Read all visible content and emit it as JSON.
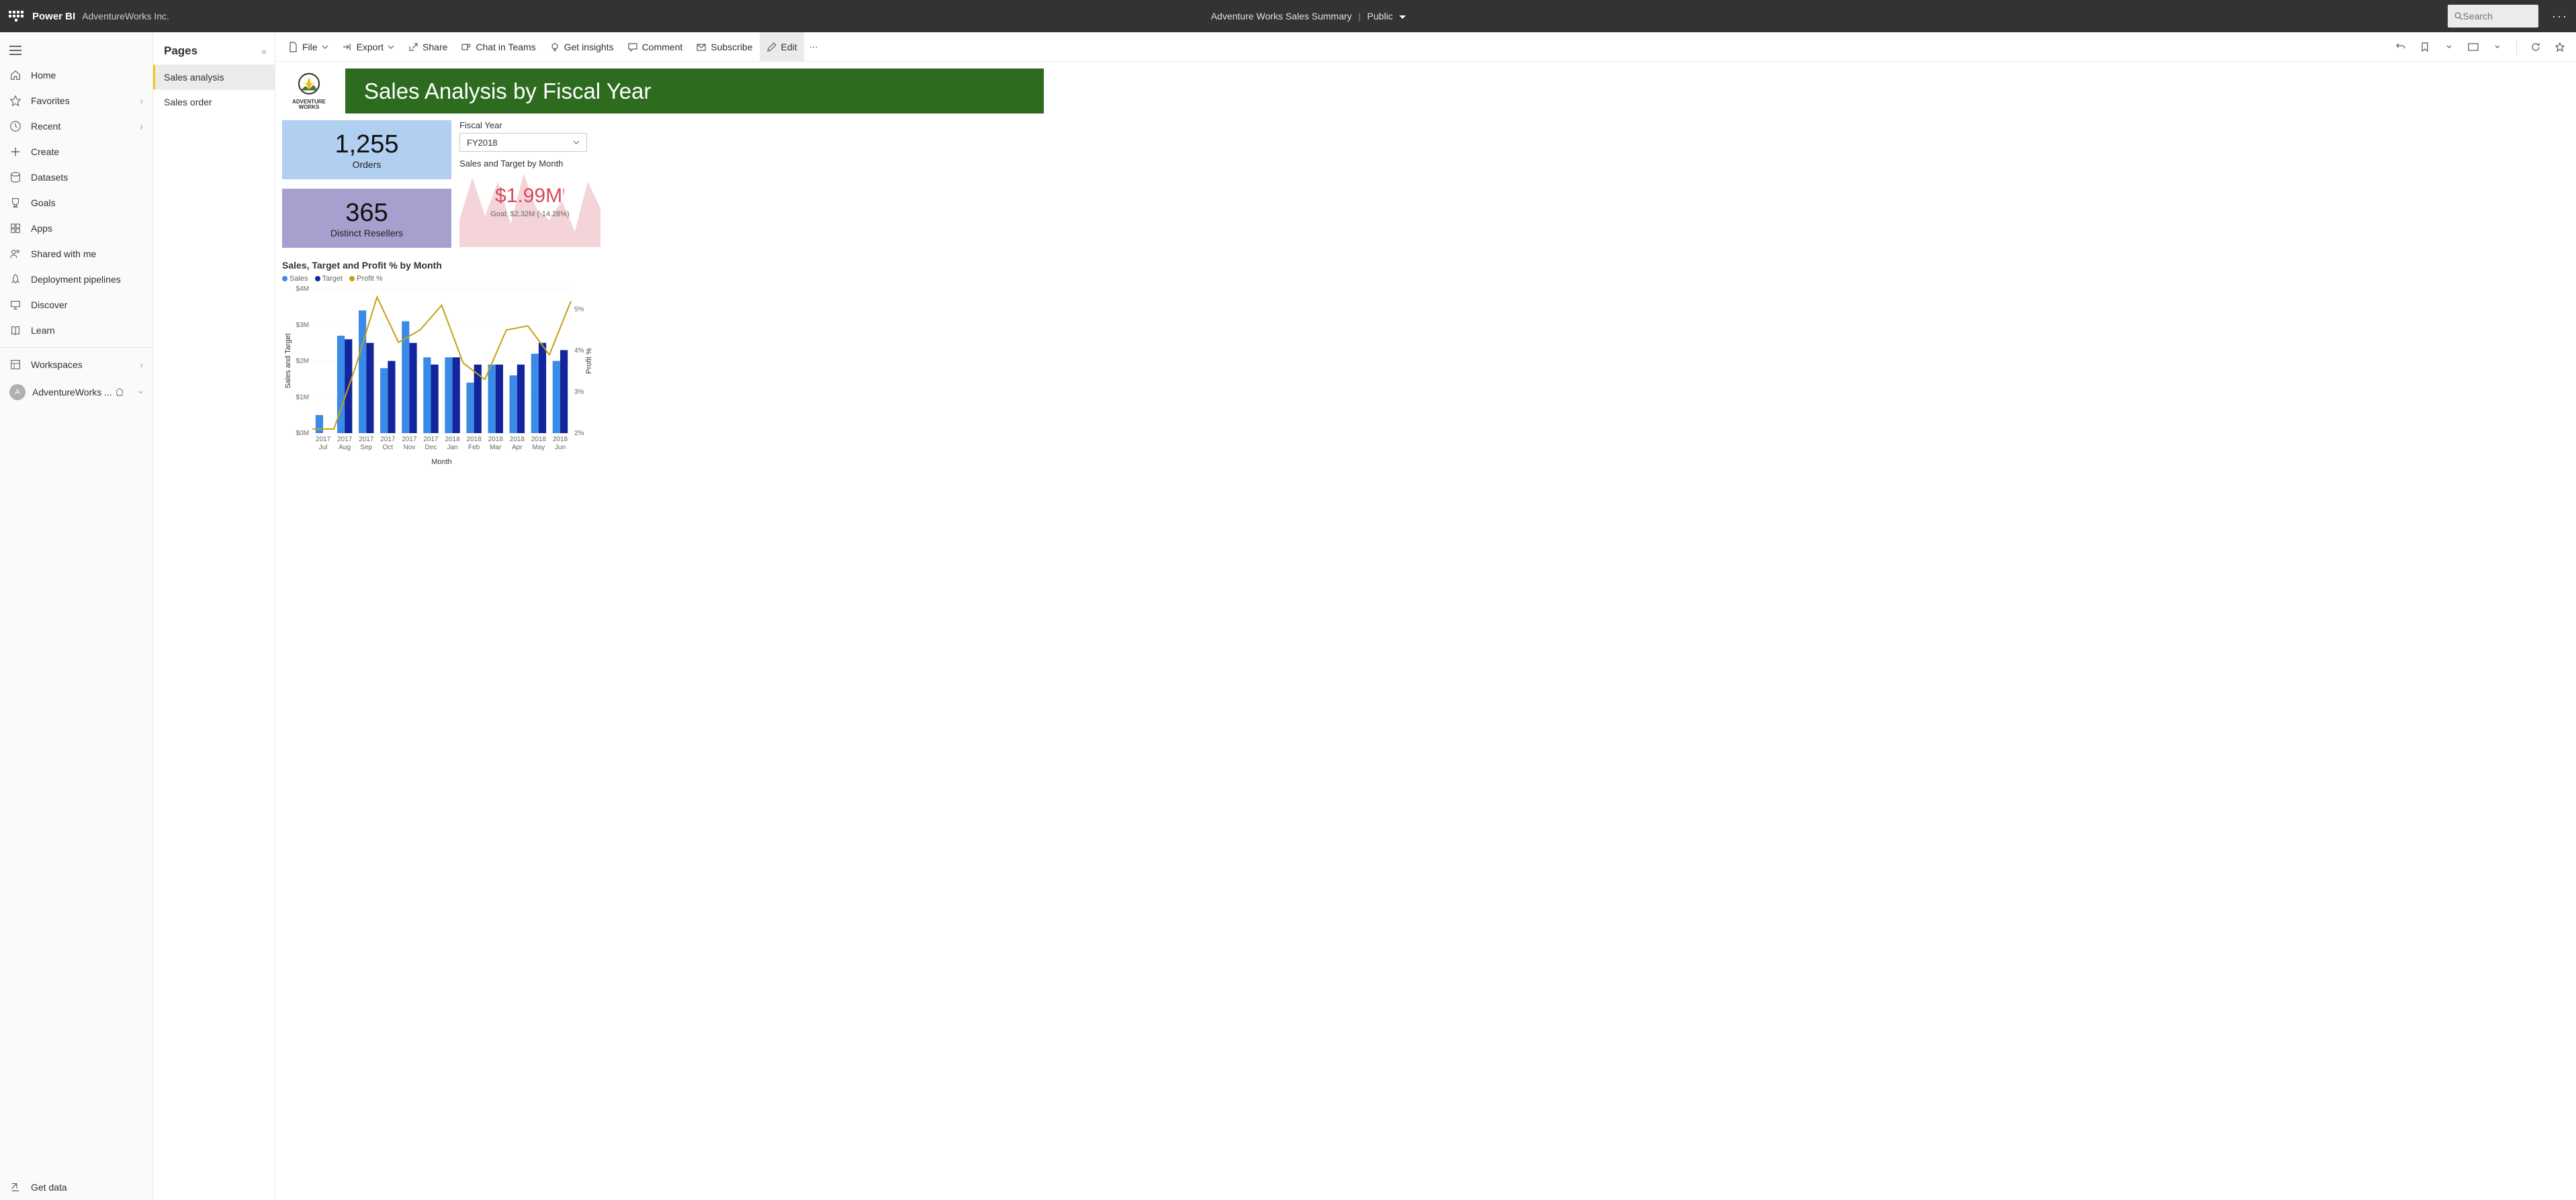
{
  "topbar": {
    "brand": "Power BI",
    "org": "AdventureWorks Inc.",
    "center_title": "Adventure Works Sales Summary",
    "center_badge": "Public",
    "search_placeholder": "Search"
  },
  "leftnav": {
    "items": [
      {
        "id": "home",
        "label": "Home"
      },
      {
        "id": "favorites",
        "label": "Favorites",
        "chev": true
      },
      {
        "id": "recent",
        "label": "Recent",
        "chev": true
      },
      {
        "id": "create",
        "label": "Create"
      },
      {
        "id": "datasets",
        "label": "Datasets"
      },
      {
        "id": "goals",
        "label": "Goals"
      },
      {
        "id": "apps",
        "label": "Apps"
      },
      {
        "id": "shared",
        "label": "Shared with me"
      },
      {
        "id": "pipelines",
        "label": "Deployment pipelines"
      },
      {
        "id": "discover",
        "label": "Discover"
      },
      {
        "id": "learn",
        "label": "Learn"
      }
    ],
    "workspaces_label": "Workspaces",
    "current_workspace": "AdventureWorks ...",
    "get_data": "Get data"
  },
  "pages": {
    "title": "Pages",
    "items": [
      "Sales analysis",
      "Sales order"
    ],
    "active": 0
  },
  "cmdbar": {
    "file": "File",
    "export": "Export",
    "share": "Share",
    "chat": "Chat in Teams",
    "insights": "Get insights",
    "comment": "Comment",
    "subscribe": "Subscribe",
    "edit": "Edit"
  },
  "report": {
    "logo_top": "ADVENTURE",
    "logo_bot": "WORKS",
    "title": "Sales Analysis by Fiscal Year",
    "orders_value": "1,255",
    "orders_label": "Orders",
    "resellers_value": "365",
    "resellers_label": "Distinct Resellers",
    "fy_label": "Fiscal Year",
    "fy_value": "FY2018",
    "spark_title": "Sales and Target by Month",
    "spark_value": "$1.99M",
    "spark_goal": "Goal: $2.32M (-14.28%)",
    "chart_title": "Sales, Target and Profit % by Month",
    "legend": {
      "sales": "Sales",
      "target": "Target",
      "profit": "Profit %"
    },
    "y1_title": "Sales and Target",
    "y2_title": "Profit %",
    "x_title": "Month"
  },
  "chart_data": {
    "type": "bar",
    "categories": [
      "2017 Jul",
      "2017 Aug",
      "2017 Sep",
      "2017 Oct",
      "2017 Nov",
      "2017 Dec",
      "2018 Jan",
      "2018 Feb",
      "2018 Mar",
      "2018 Apr",
      "2018 May",
      "2018 Jun"
    ],
    "series": [
      {
        "name": "Sales",
        "values": [
          0.5,
          2.7,
          3.4,
          1.8,
          3.1,
          2.1,
          2.1,
          1.4,
          1.9,
          1.6,
          2.2,
          2.0
        ],
        "color": "#3a8be8"
      },
      {
        "name": "Target",
        "values": [
          0.0,
          2.6,
          2.5,
          2.0,
          2.5,
          1.9,
          2.1,
          1.9,
          1.9,
          1.9,
          2.5,
          2.3
        ],
        "color": "#13259c"
      },
      {
        "name": "Profit %",
        "values": [
          2.1,
          2.1,
          3.6,
          5.3,
          4.2,
          4.5,
          5.1,
          3.7,
          3.3,
          4.5,
          4.6,
          3.9,
          5.2
        ],
        "color": "#c2a20e",
        "type": "line",
        "axis": "right"
      }
    ],
    "yticks": [
      "$0M",
      "$1M",
      "$2M",
      "$3M",
      "$4M"
    ],
    "y2ticks": [
      "2%",
      "3%",
      "4%",
      "5%"
    ],
    "ylim": [
      0,
      4
    ],
    "y2lim": [
      2,
      5.5
    ],
    "xlabel": "Month",
    "ylabel": "Sales and Target",
    "y2label": "Profit %"
  },
  "spark_data": {
    "type": "area",
    "values": [
      35,
      90,
      40,
      85,
      30,
      95,
      50,
      35,
      60,
      20,
      85,
      50
    ]
  }
}
